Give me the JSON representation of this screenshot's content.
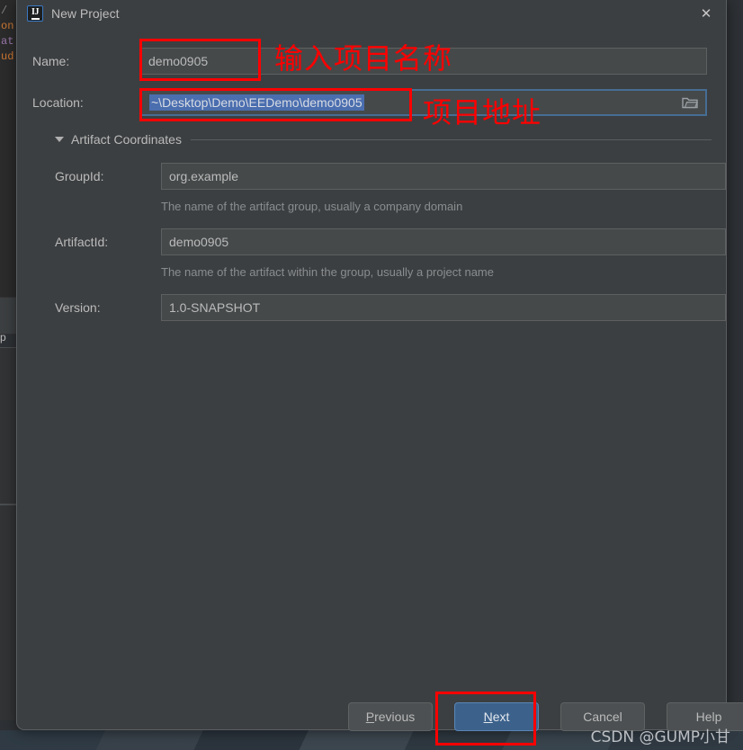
{
  "window": {
    "title": "New Project",
    "app_icon": "intellij-idea-icon",
    "close_icon": "close-icon"
  },
  "form": {
    "name": {
      "label": "Name:",
      "value": "demo0905"
    },
    "location": {
      "label": "Location:",
      "value": "~\\Desktop\\Demo\\EEDemo\\demo0905",
      "browse_icon": "folder-icon"
    }
  },
  "artifact_section": {
    "title": "Artifact Coordinates",
    "expanded": true,
    "fields": [
      {
        "label": "GroupId:",
        "value": "org.example",
        "hint": "The name of the artifact group, usually a company domain"
      },
      {
        "label": "ArtifactId:",
        "value": "demo0905",
        "hint": "The name of the artifact within the group, usually a project name"
      },
      {
        "label": "Version:",
        "value": "1.0-SNAPSHOT",
        "hint": ""
      }
    ]
  },
  "buttons": {
    "previous": "Previous",
    "next": "Next",
    "cancel": "Cancel",
    "help": "Help"
  },
  "annotations": {
    "name_note": "输入项目名称",
    "location_note": "项目地址",
    "color": "#ff0000"
  },
  "watermark": "CSDN @GUMP小甘",
  "background": {
    "code_lines": [
      "/",
      "on",
      "at",
      "ud"
    ],
    "panel_text": "p"
  },
  "colors": {
    "dialog_bg": "#3c3f41",
    "field_bg": "#45494a",
    "accent_blue": "#3c628c",
    "selection_blue": "#4b6eaf",
    "text": "#bbbbbb",
    "hint_text": "#8a8d8f"
  }
}
